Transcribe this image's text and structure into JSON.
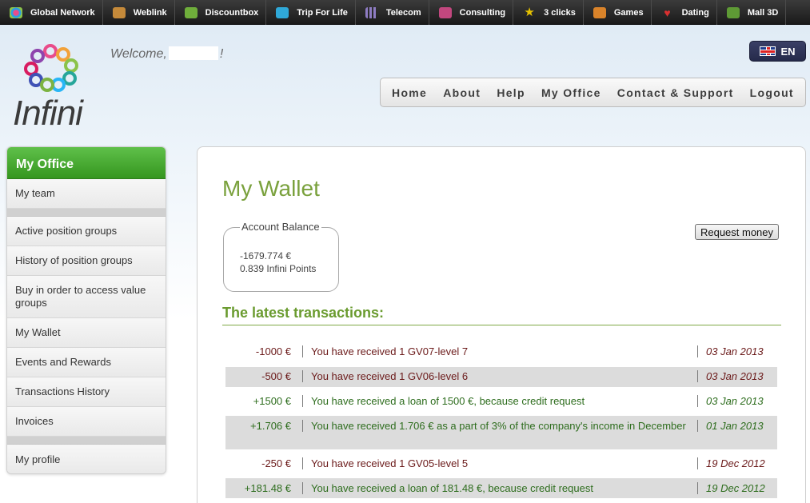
{
  "network_bar": [
    {
      "label": "Global Network",
      "icon": "flower-icon"
    },
    {
      "label": "Weblink",
      "icon": "cloud-icon"
    },
    {
      "label": "Discountbox",
      "icon": "cube-icon"
    },
    {
      "label": "Trip For Life",
      "icon": "camera-icon"
    },
    {
      "label": "Telecom",
      "icon": "signal-bars-icon"
    },
    {
      "label": "Consulting",
      "icon": "briefcase-icon"
    },
    {
      "label": "3 clicks",
      "icon": "star-icon"
    },
    {
      "label": "Games",
      "icon": "gamepad-icon"
    },
    {
      "label": "Dating",
      "icon": "heart-icon"
    },
    {
      "label": "Mall 3D",
      "icon": "shopping-bag-icon"
    }
  ],
  "header": {
    "logo_text": "Infini",
    "welcome_prefix": "Welcome,",
    "welcome_suffix": "!",
    "language": "EN",
    "nav": [
      "Home",
      "About",
      "Help",
      "My Office",
      "Contact & Support",
      "Logout"
    ]
  },
  "sidebar": {
    "title": "My Office",
    "items": [
      "My team",
      "Active position groups",
      "History of position groups",
      "Buy in order to access value groups",
      "My Wallet",
      "Events and Rewards",
      "Transactions History",
      "Invoices",
      "My profile"
    ]
  },
  "main": {
    "title": "My Wallet",
    "balance": {
      "legend": "Account Balance",
      "euro": "-1679.774 €",
      "points": "0.839 Infini Points"
    },
    "request_button": "Request money",
    "latest_title": "The latest transactions:",
    "transactions": [
      {
        "amount": "-1000 €",
        "description": "You have received 1 GV07-level 7",
        "date": "03 Jan 2013",
        "sign": "neg"
      },
      {
        "amount": "-500 €",
        "description": "You have received 1 GV06-level 6",
        "date": "03 Jan 2013",
        "sign": "neg"
      },
      {
        "amount": "+1500 €",
        "description": "You have received a loan of 1500 €, because credit request",
        "date": "03 Jan 2013",
        "sign": "pos"
      },
      {
        "amount": "+1.706 €",
        "description": "You have received 1.706 € as a part of 3% of the company's income in December",
        "date": "01 Jan 2013",
        "sign": "pos"
      },
      {
        "amount": "-250 €",
        "description": "You have received 1 GV05-level 5",
        "date": "19 Dec 2012",
        "sign": "neg"
      },
      {
        "amount": "+181.48 €",
        "description": "You have received a loan of 181.48 €, because credit request",
        "date": "19 Dec 2012",
        "sign": "pos"
      }
    ]
  }
}
